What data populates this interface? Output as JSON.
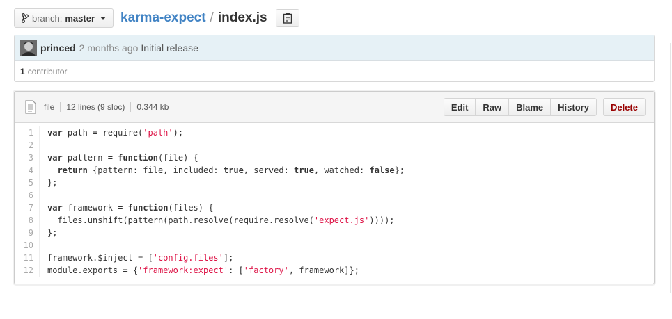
{
  "toolbar": {
    "branch_label": "branch:",
    "branch_name": "master",
    "repo": "karma-expect",
    "separator": "/",
    "file": "index.js",
    "icons": {
      "branch": "git-branch-icon",
      "clipboard": "clipboard-icon",
      "caret": "chevron-down-icon"
    }
  },
  "commit": {
    "author": "princed",
    "age": "2 months ago",
    "message": "Initial release",
    "contributors_count": "1",
    "contributors_label": "contributor"
  },
  "file_meta": {
    "type": "file",
    "lines": "12 lines (9 sloc)",
    "size": "0.344 kb"
  },
  "actions": {
    "edit": "Edit",
    "raw": "Raw",
    "blame": "Blame",
    "history": "History",
    "delete": "Delete"
  },
  "code_lines": [
    [
      [
        "k",
        "var"
      ],
      [
        "t",
        " path = require("
      ],
      [
        "s",
        "'path'"
      ],
      [
        "t",
        ");"
      ]
    ],
    [],
    [
      [
        "k",
        "var"
      ],
      [
        "t",
        " pattern "
      ],
      [
        "k",
        "="
      ],
      [
        "t",
        " "
      ],
      [
        "k",
        "function"
      ],
      [
        "t",
        "(file) {"
      ]
    ],
    [
      [
        "t",
        "  "
      ],
      [
        "k",
        "return"
      ],
      [
        "t",
        " {pattern: file, included: "
      ],
      [
        "k",
        "true"
      ],
      [
        "t",
        ", served: "
      ],
      [
        "k",
        "true"
      ],
      [
        "t",
        ", watched: "
      ],
      [
        "k",
        "false"
      ],
      [
        "t",
        "};"
      ]
    ],
    [
      [
        "t",
        "};"
      ]
    ],
    [],
    [
      [
        "k",
        "var"
      ],
      [
        "t",
        " framework "
      ],
      [
        "k",
        "="
      ],
      [
        "t",
        " "
      ],
      [
        "k",
        "function"
      ],
      [
        "t",
        "(files) {"
      ]
    ],
    [
      [
        "t",
        "  files.unshift(pattern(path.resolve(require.resolve("
      ],
      [
        "s",
        "'expect.js'"
      ],
      [
        "t",
        "))));"
      ]
    ],
    [
      [
        "t",
        "};"
      ]
    ],
    [],
    [
      [
        "t",
        "framework.$inject = ["
      ],
      [
        "s",
        "'config.files'"
      ],
      [
        "t",
        "];"
      ]
    ],
    [
      [
        "t",
        "module.exports = {"
      ],
      [
        "s",
        "'framework:expect'"
      ],
      [
        "t",
        ": ["
      ],
      [
        "s",
        "'factory'"
      ],
      [
        "t",
        ", framework]};"
      ]
    ]
  ],
  "line_numbers": [
    "1",
    "2",
    "3",
    "4",
    "5",
    "6",
    "7",
    "8",
    "9",
    "10",
    "11",
    "12"
  ]
}
